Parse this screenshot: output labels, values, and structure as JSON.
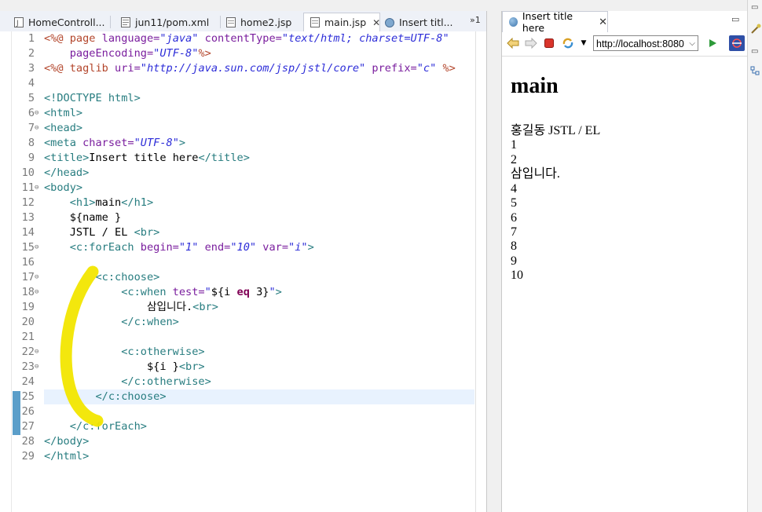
{
  "editor": {
    "tabs": [
      {
        "label": "HomeControll...",
        "icon": "java-file-icon"
      },
      {
        "label": "jun11/pom.xml",
        "icon": "xml-file-icon"
      },
      {
        "label": "home2.jsp",
        "icon": "jsp-file-icon"
      },
      {
        "label": "main.jsp",
        "icon": "jsp-file-icon",
        "active": true
      },
      {
        "label": "Insert titl...",
        "icon": "browser-globe-icon"
      }
    ],
    "overflow_count": "»1",
    "close_glyph": "✕",
    "line_numbers": [
      "1",
      "2",
      "3",
      "4",
      "5",
      "6",
      "7",
      "8",
      "9",
      "10",
      "11",
      "12",
      "13",
      "14",
      "15",
      "16",
      "17",
      "18",
      "19",
      "20",
      "21",
      "22",
      "23",
      "24",
      "25",
      "26",
      "27",
      "28",
      "29"
    ],
    "code": {
      "l1a": "<%@",
      "l1b": " page ",
      "l1c": "language=",
      "l1d": "\"java\"",
      "l1e": " contentType=",
      "l1f": "\"text/html; charset=UTF-8\"",
      "l2a": "    pageEncoding=",
      "l2b": "\"UTF-8\"",
      "l2c": "%>",
      "l3a": "<%@",
      "l3b": " taglib ",
      "l3c": "uri=",
      "l3d": "\"http://java.sun.com/jsp/jstl/core\"",
      "l3e": " prefix=",
      "l3f": "\"c\"",
      "l3g": " %>",
      "l5": "<!DOCTYPE html>",
      "l6": "<html>",
      "l7": "<head>",
      "l8a": "<meta",
      "l8b": " charset=",
      "l8c": "\"UTF-8\"",
      "l8d": ">",
      "l9a": "<title>",
      "l9b": "Insert title here",
      "l9c": "</title>",
      "l10": "</head>",
      "l11": "<body>",
      "l12a": "    <h1>",
      "l12b": "main",
      "l12c": "</h1>",
      "l13": "    ${name }",
      "l14a": "    JSTL / EL ",
      "l14b": "<br>",
      "l15a": "    <c:forEach",
      "l15b": " begin=",
      "l15c": "\"1\"",
      "l15d": " end=",
      "l15e": "\"10\"",
      "l15f": " var=",
      "l15g": "\"i\"",
      "l15h": ">",
      "l17": "        <c:choose>",
      "l18a": "            <c:when",
      "l18b": " test=",
      "l18c": "\"",
      "l18d": "${i ",
      "l18e": "eq",
      "l18f": " 3}",
      "l18g": "\"",
      "l18h": ">",
      "l19a": "                삼입니다.",
      "l19b": "<br>",
      "l20": "            </c:when>",
      "l22": "            <c:otherwise>",
      "l23a": "                ${i }",
      "l23b": "<br>",
      "l24": "            </c:otherwise>",
      "l25": "        </c:choose>",
      "l27": "    </c:forEach>",
      "l28": "</body>",
      "l29": "</html>"
    }
  },
  "browser": {
    "tab_label": "Insert title here",
    "url": "http://localhost:8080",
    "heading": "main",
    "output_lines": [
      "홍길동 JSTL / EL",
      "1",
      "2",
      "삼입니다.",
      "4",
      "5",
      "6",
      "7",
      "8",
      "9",
      "10"
    ],
    "toolbar_icons": [
      "back-icon",
      "forward-icon",
      "stop-icon",
      "refresh-icon",
      "menu-dropdown-icon",
      "go-icon",
      "open-external-icon"
    ]
  },
  "colors": {
    "tag": "#287d80",
    "directive": "#b3462c",
    "attribute": "#7a1e9e",
    "string": "#2d2dd8",
    "keyword": "#800055",
    "highlight_line": "#e8f2fe",
    "annotation": "#f2e600"
  }
}
